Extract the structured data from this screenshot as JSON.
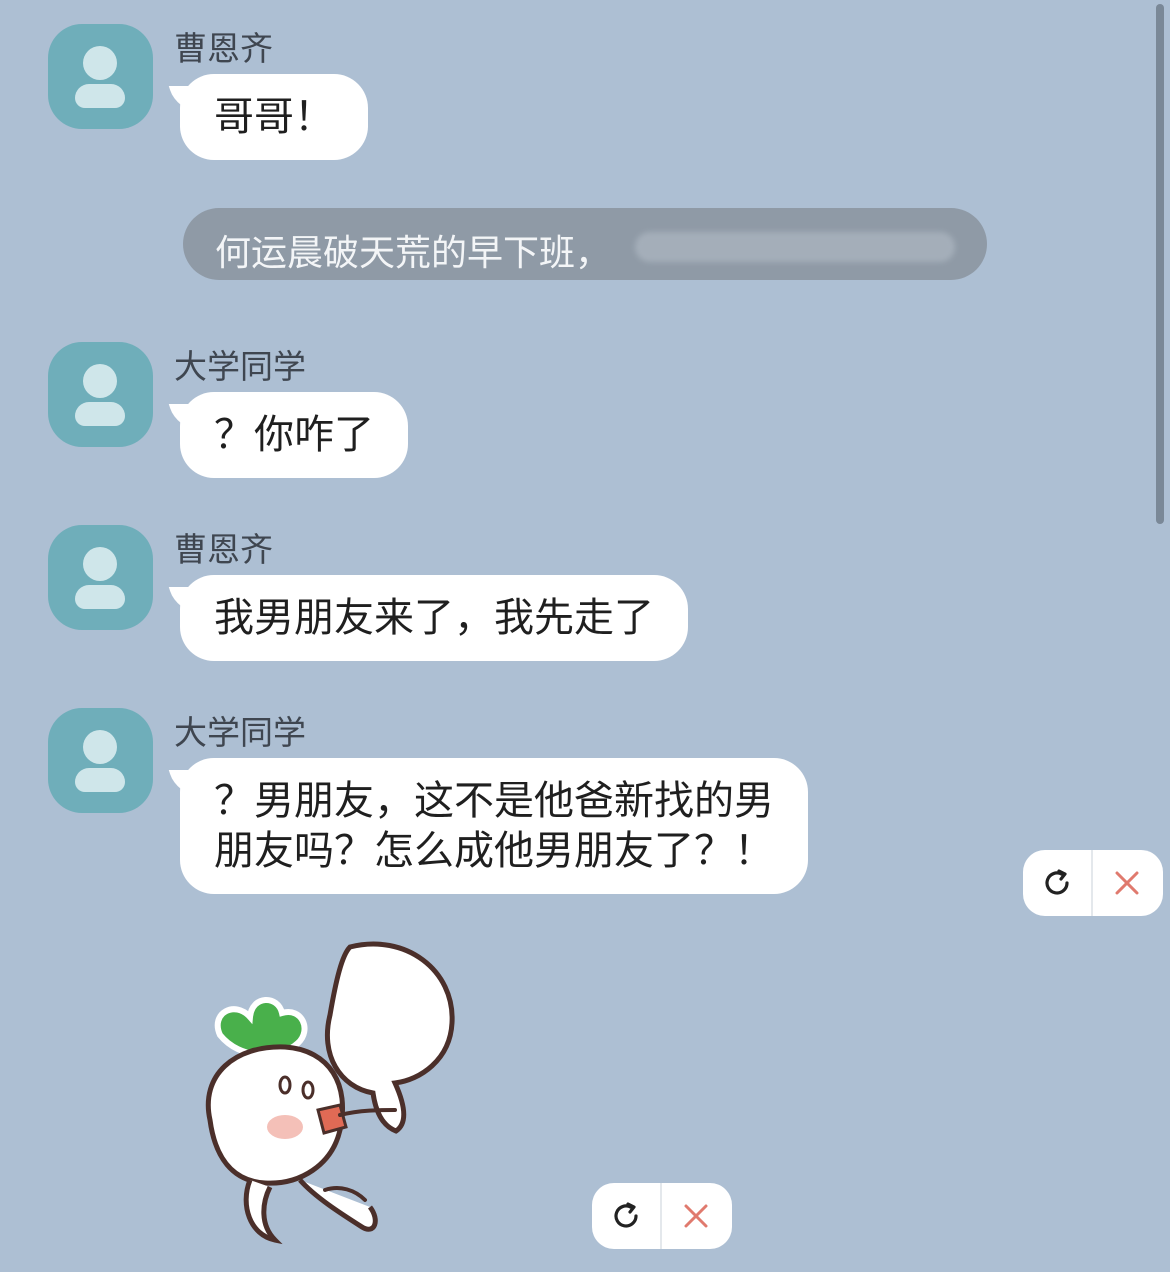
{
  "messages": [
    {
      "sender": "曹恩齐",
      "line1": "哥哥！"
    },
    {
      "sender": "大学同学",
      "line1": "？你咋了"
    },
    {
      "sender": "曹恩齐",
      "line1": "我男朋友来了，我先走了"
    },
    {
      "sender": "大学同学",
      "line1": "？男朋友，这不是他爸新找的男",
      "line2": "朋友吗？怎么成他男朋友了？！"
    }
  ],
  "system_notice": {
    "text": "何运晨破天荒的早下班，"
  },
  "icons": {
    "avatar": "person-icon",
    "retry": "refresh-icon",
    "delete": "close-icon",
    "sticker": "radish-sticker"
  },
  "colors": {
    "background": "#adbfd3",
    "avatar": "#6faeba",
    "bubble": "#ffffff",
    "delete_icon": "#e07a6e",
    "sticker_leaf": "#49b04b"
  }
}
